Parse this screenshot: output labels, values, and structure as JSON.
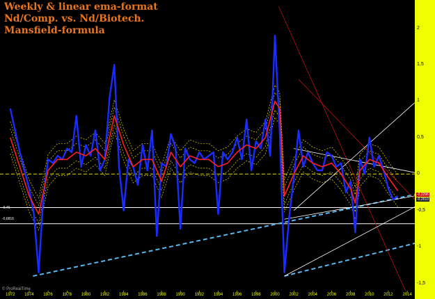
{
  "title_lines": [
    "Weekly & linear ema-format",
    "Nd/Comp. vs. Nd/Biotech.",
    "Mansfield-formula"
  ],
  "credit": "© ProRealTime",
  "colors": {
    "background": "#000000",
    "axis_panel": "#f0ff00",
    "title": "#e8761e",
    "price": "#1a2cff",
    "ema": "#ff2020",
    "bands": "#e8e000",
    "zero_line": "#e8e000",
    "trend_dashed": "#5ab8f0",
    "channel_red": "#c01010",
    "channel_white": "#ffffff"
  },
  "level_labels": {
    "level_1": "-0,46",
    "level_2": "-0,6816"
  },
  "box_labels": {
    "last_red": "-0,2296",
    "last_dark": "-0,2610"
  },
  "chart_data": {
    "type": "line",
    "title": "Weekly & linear ema-format Nd/Comp. vs. Nd/Biotech. Mansfield-formula",
    "xlabel": "",
    "ylabel": "",
    "x_ticks": [
      "1972",
      "1974",
      "1976",
      "1978",
      "1980",
      "1982",
      "1984",
      "1986",
      "1988",
      "1990",
      "1992",
      "1994",
      "1996",
      "1998",
      "2000",
      "2002",
      "2004",
      "2006",
      "2008",
      "2010",
      "2012",
      "2014"
    ],
    "y_ticks": [
      "2",
      "1,5",
      "1",
      "0,5",
      "0",
      "-0,5",
      "-1",
      "-1,5"
    ],
    "ylim": [
      -1.6,
      2.35
    ],
    "xlim": [
      1971.5,
      2014.8
    ],
    "grid": false,
    "horizontal_lines": [
      {
        "y": 0,
        "style": "dashed",
        "color": "#e8e000"
      },
      {
        "y": -0.46,
        "style": "solid",
        "color": "#ffffff"
      },
      {
        "y": -0.6816,
        "style": "solid",
        "color": "#ffffff"
      }
    ],
    "trend_lines": [
      {
        "from": [
          1974.4,
          -1.4
        ],
        "to": [
          2014.8,
          -0.28
        ],
        "style": "dashed",
        "color": "#5ab8f0"
      },
      {
        "from": [
          2001.0,
          -1.4
        ],
        "to": [
          2014.8,
          -0.95
        ],
        "style": "dashed",
        "color": "#5ab8f0"
      },
      {
        "from": [
          2000.4,
          2.3
        ],
        "to": [
          2013.8,
          -1.6
        ],
        "style": "solid",
        "color": "#c01010"
      },
      {
        "from": [
          2002.5,
          1.3
        ],
        "to": [
          2014.8,
          -0.35
        ],
        "style": "solid",
        "color": "#c01010"
      },
      {
        "from": [
          2002.0,
          -0.5
        ],
        "to": [
          2014.8,
          0.98
        ],
        "style": "solid",
        "color": "#ffffff"
      },
      {
        "from": [
          2002.0,
          0.35
        ],
        "to": [
          2014.8,
          0.02
        ],
        "style": "solid",
        "color": "#ffffff"
      },
      {
        "from": [
          2001.0,
          -1.4
        ],
        "to": [
          2014.8,
          -0.45
        ],
        "style": "solid",
        "color": "#ffffff"
      },
      {
        "from": [
          2001.0,
          -0.62
        ],
        "to": [
          2014.8,
          -0.3
        ],
        "style": "solid",
        "color": "#ffffff"
      }
    ],
    "series": [
      {
        "x": [
          1972.0,
          1972.5,
          1973.0,
          1973.5,
          1974.0,
          1974.5,
          1975.0,
          1975.5,
          1976.0,
          1976.5,
          1977.0,
          1977.5,
          1978.0,
          1978.5,
          1979.0,
          1979.5,
          1980.0,
          1980.5,
          1981.0,
          1981.5,
          1982.0,
          1982.5,
          1983.0,
          1983.5,
          1984.0,
          1984.5,
          1985.0,
          1985.5,
          1986.0,
          1986.5,
          1987.0,
          1987.5,
          1988.0,
          1988.5,
          1989.0,
          1989.5,
          1990.0,
          1990.5,
          1991.0,
          1991.5,
          1992.0,
          1992.5,
          1993.0,
          1993.5,
          1994.0,
          1994.5,
          1995.0,
          1995.5,
          1996.0,
          1996.5,
          1997.0,
          1997.5,
          1998.0,
          1998.5,
          1999.0,
          1999.5,
          2000.0,
          2000.5,
          2001.0,
          2001.5,
          2002.0,
          2002.5,
          2003.0,
          2003.5,
          2004.0,
          2004.5,
          2005.0,
          2005.5,
          2006.0,
          2006.5,
          2007.0,
          2007.5,
          2008.0,
          2008.5,
          2009.0,
          2009.5,
          2010.0,
          2010.5,
          2011.0,
          2011.5,
          2012.0,
          2012.5,
          2013.0
        ],
        "values": [
          0.9,
          0.6,
          0.3,
          0.05,
          -0.2,
          -0.55,
          -1.35,
          -0.3,
          0.2,
          0.15,
          0.25,
          0.2,
          0.35,
          0.3,
          0.8,
          0.1,
          0.4,
          0.25,
          0.6,
          0.05,
          0.2,
          1.05,
          1.5,
          0.1,
          -0.5,
          0.2,
          0.1,
          -0.15,
          0.4,
          0.05,
          0.6,
          -0.85,
          0.15,
          0.1,
          0.55,
          0.35,
          -0.75,
          0.35,
          0.2,
          0.15,
          0.3,
          0.2,
          0.25,
          0.3,
          -0.55,
          0.3,
          0.2,
          0.3,
          0.5,
          0.2,
          0.75,
          0.05,
          0.45,
          0.35,
          0.75,
          0.25,
          1.9,
          0.6,
          -1.35,
          -0.6,
          -0.05,
          0.6,
          0.1,
          0.3,
          0.15,
          0.05,
          0.05,
          0.3,
          0.25,
          0.1,
          0.15,
          -0.25,
          -0.1,
          -0.8,
          0.2,
          0.0,
          0.5,
          0.1,
          0.25,
          0.05,
          -0.2,
          -0.35,
          -0.3
        ]
      },
      {
        "x": [
          1972.0,
          1973.0,
          1974.0,
          1975.0,
          1976.0,
          1977.0,
          1978.0,
          1979.0,
          1980.0,
          1981.0,
          1982.0,
          1983.0,
          1984.0,
          1985.0,
          1986.0,
          1987.0,
          1988.0,
          1989.0,
          1990.0,
          1991.0,
          1992.0,
          1993.0,
          1994.0,
          1995.0,
          1996.0,
          1997.0,
          1998.0,
          1999.0,
          2000.0,
          2000.5,
          2001.0,
          2002.0,
          2003.0,
          2004.0,
          2005.0,
          2006.0,
          2007.0,
          2008.0,
          2008.5,
          2009.0,
          2010.0,
          2011.0,
          2012.0,
          2013.0
        ],
        "values": [
          0.5,
          0.1,
          -0.3,
          -0.55,
          0.05,
          0.2,
          0.2,
          0.3,
          0.25,
          0.35,
          0.2,
          0.8,
          0.4,
          0.1,
          0.2,
          0.2,
          -0.1,
          0.3,
          0.1,
          0.25,
          0.2,
          0.2,
          0.1,
          0.15,
          0.3,
          0.4,
          0.35,
          0.5,
          1.0,
          0.9,
          -0.3,
          0.0,
          0.25,
          0.15,
          0.1,
          0.15,
          0.0,
          -0.2,
          -0.4,
          0.05,
          0.2,
          0.15,
          -0.05,
          -0.23
        ]
      }
    ]
  }
}
